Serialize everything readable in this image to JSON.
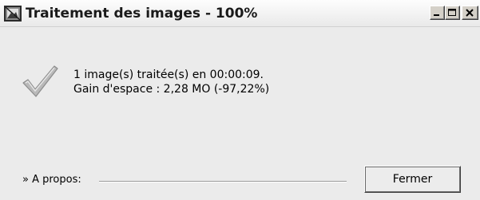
{
  "window": {
    "title": "Traitement des images - 100%",
    "icon": "app-image-icon",
    "controls": [
      "minimize-icon",
      "maximize-icon",
      "close-icon"
    ]
  },
  "message": {
    "icon": "checkmark-icon",
    "line1": "1 image(s) traitée(s) en 00:00:09.",
    "line2": "Gain d'espace : 2,28 MO (-97,22%)"
  },
  "footer": {
    "about_label": "» A propos:",
    "close_label": "Fermer"
  }
}
